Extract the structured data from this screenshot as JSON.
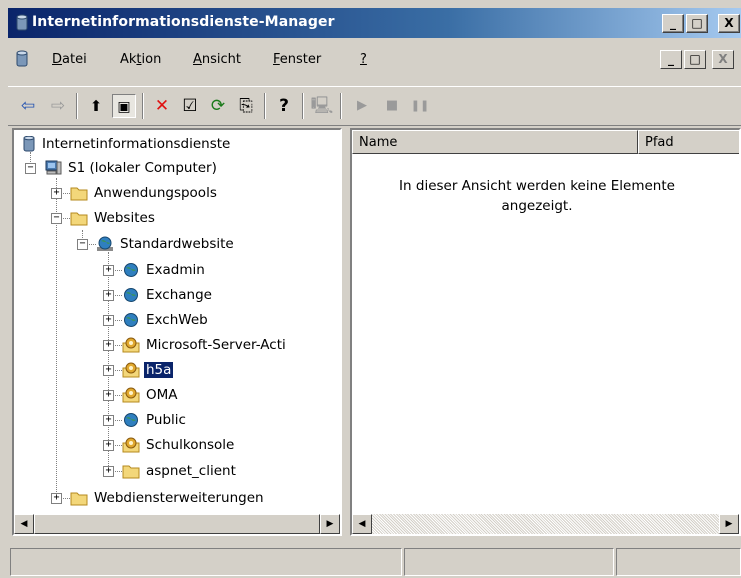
{
  "window": {
    "title": "Internetinformationsdienste-Manager"
  },
  "caption_buttons": {
    "minimize": "_",
    "maximize": "□",
    "close": "X"
  },
  "menu": [
    {
      "label": "Datei",
      "underline": "D",
      "rest": "atei"
    },
    {
      "label": "Aktion",
      "pre": "Ak",
      "underline": "t",
      "rest": "ion"
    },
    {
      "label": "Ansicht",
      "underline": "A",
      "rest": "nsicht"
    },
    {
      "label": "Fenster",
      "underline": "F",
      "rest": "enster"
    },
    {
      "label": "?",
      "underline": "?",
      "rest": ""
    }
  ],
  "toolbar": {
    "back": "⇦",
    "forward": "⇨",
    "up": "⬆",
    "show_tree": "▣",
    "delete": "✕",
    "properties": "☑",
    "refresh": "⟳",
    "export": "⎘",
    "help": "?",
    "connect": "🖳",
    "start": "▶",
    "stop": "■",
    "pause": "❚❚"
  },
  "tree": {
    "root": "Internetinformationsdienste",
    "computer": "S1 (lokaler Computer)",
    "app_pools": "Anwendungspools",
    "websites": "Websites",
    "default_site": "Standardwebsite",
    "children": [
      {
        "label": "Exadmin",
        "icon": "globe"
      },
      {
        "label": "Exchange",
        "icon": "globe"
      },
      {
        "label": "ExchWeb",
        "icon": "globe"
      },
      {
        "label": "Microsoft-Server-Acti",
        "icon": "gear"
      },
      {
        "label": "h5a",
        "icon": "gear",
        "selected": true
      },
      {
        "label": "OMA",
        "icon": "gear"
      },
      {
        "label": "Public",
        "icon": "globe"
      },
      {
        "label": "Schulkonsole",
        "icon": "gear"
      },
      {
        "label": "aspnet_client",
        "icon": "folder"
      }
    ],
    "web_service_extensions": "Webdiensterweiterungen"
  },
  "list": {
    "columns": [
      "Name",
      "Pfad"
    ],
    "empty_message": "In dieser Ansicht werden keine Elemente angezeigt."
  },
  "colors": {
    "title_start": "#0a246a",
    "title_end": "#a6caf0",
    "selection": "#0a246a",
    "chrome": "#d4d0c8"
  }
}
